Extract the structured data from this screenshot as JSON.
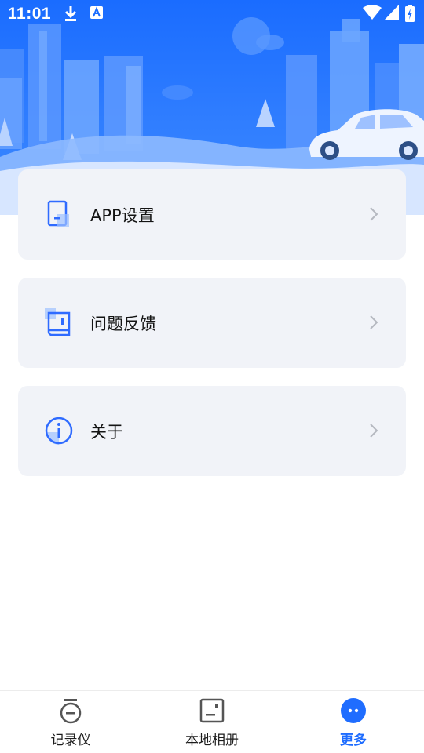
{
  "status_bar": {
    "time": "11:01",
    "left_icons": [
      "download-icon",
      "text-a-icon"
    ],
    "right_icons": [
      "wifi-icon",
      "signal-icon",
      "battery-charging-icon"
    ]
  },
  "header": {
    "illustration": "city-skyline-with-car",
    "accent": "#1a6cff"
  },
  "menu": {
    "items": [
      {
        "label": "APP设置",
        "icon": "app-settings-icon"
      },
      {
        "label": "问题反馈",
        "icon": "feedback-book-icon"
      },
      {
        "label": "关于",
        "icon": "info-icon"
      }
    ],
    "chevron_icon": "chevron-right-icon"
  },
  "tabbar": {
    "active_color": "#1f6dff",
    "tabs": [
      {
        "label": "记录仪",
        "icon": "recorder-icon",
        "active": false
      },
      {
        "label": "本地相册",
        "icon": "album-icon",
        "active": false
      },
      {
        "label": "更多",
        "icon": "more-icon",
        "active": true
      }
    ]
  }
}
